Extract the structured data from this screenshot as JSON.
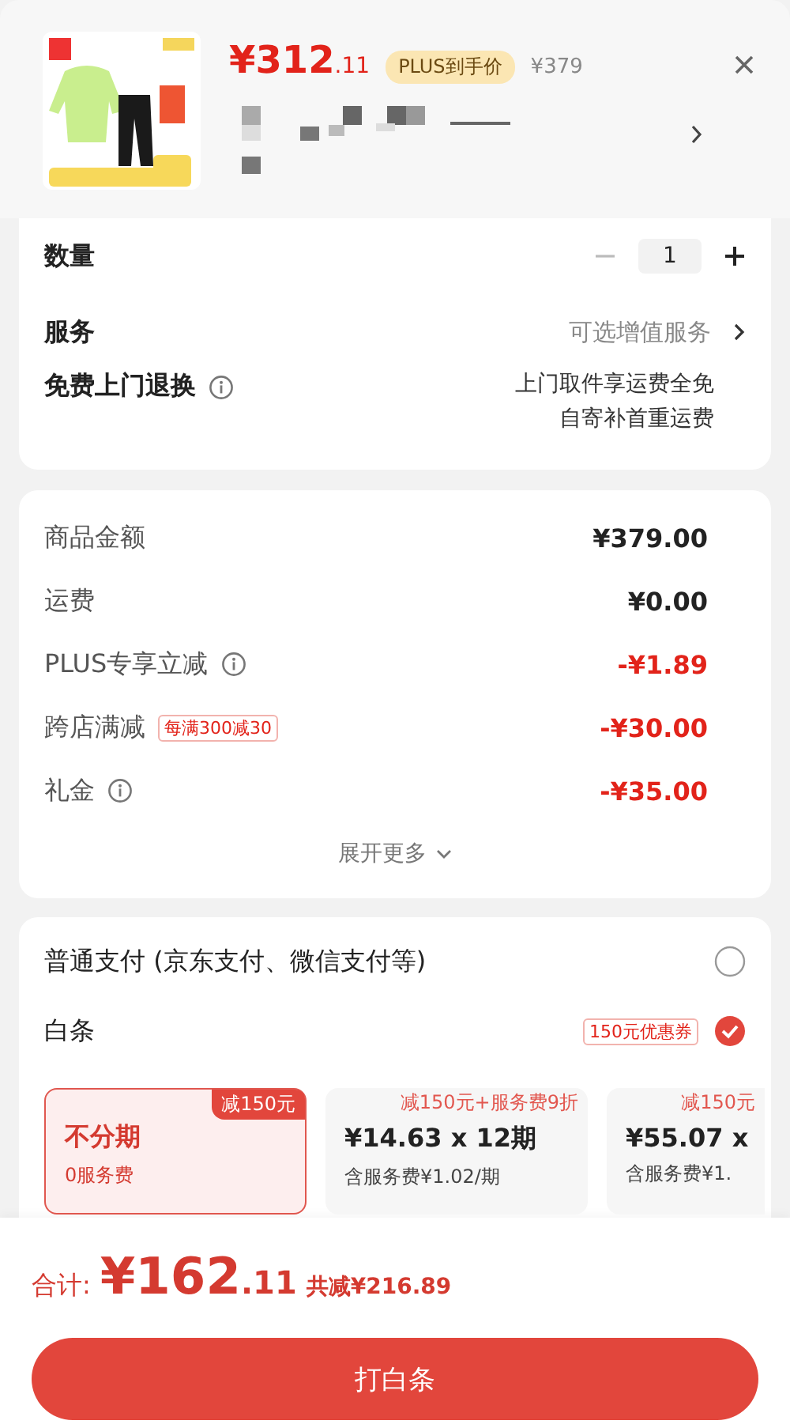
{
  "product": {
    "price_main": "¥312",
    "price_decimal": ".11",
    "price_tag": "PLUS到手价",
    "original_price": "¥379"
  },
  "order": {
    "quantity": {
      "label": "数量",
      "value": "1",
      "minus_disabled": true
    },
    "service": {
      "label": "服务",
      "value": "可选增值服务"
    },
    "returns": {
      "label": "免费上门退换",
      "lines": [
        "上门取件享运费全免",
        "自寄补首重运费"
      ]
    }
  },
  "fees": {
    "rows": [
      {
        "label": "商品金额",
        "info": false,
        "amount": "¥379.00",
        "discount": false
      },
      {
        "label": "运费",
        "info": false,
        "amount": "¥0.00",
        "discount": false
      },
      {
        "label": "PLUS专享立减",
        "info": true,
        "amount": "-¥1.89",
        "discount": true
      },
      {
        "label": "跨店满减",
        "info": false,
        "tag": "每满300减30",
        "amount": "-¥30.00",
        "discount": true
      },
      {
        "label": "礼金",
        "info": true,
        "amount": "-¥35.00",
        "discount": true
      }
    ],
    "expand": "展开更多"
  },
  "payment": {
    "methods": [
      {
        "label": "普通支付 (京东支付、微信支付等)",
        "selected": false
      },
      {
        "label": "白条",
        "coupon": "150元优惠券",
        "selected": true
      }
    ],
    "plans": [
      {
        "badge": "减150元",
        "title": "不分期",
        "sub": "0服务费",
        "selected": true
      },
      {
        "badge": "减150元+服务费9折",
        "title": "¥14.63 x 12期",
        "sub": "含服务费¥1.02/期",
        "selected": false
      },
      {
        "badge": "减150元",
        "title": "¥55.07 x",
        "sub": "含服务费¥1.",
        "selected": false
      }
    ]
  },
  "footer": {
    "total_label": "合计:",
    "total_main": "¥162",
    "total_decimal": ".11",
    "saved": "共减¥216.89",
    "button": "打白条"
  }
}
